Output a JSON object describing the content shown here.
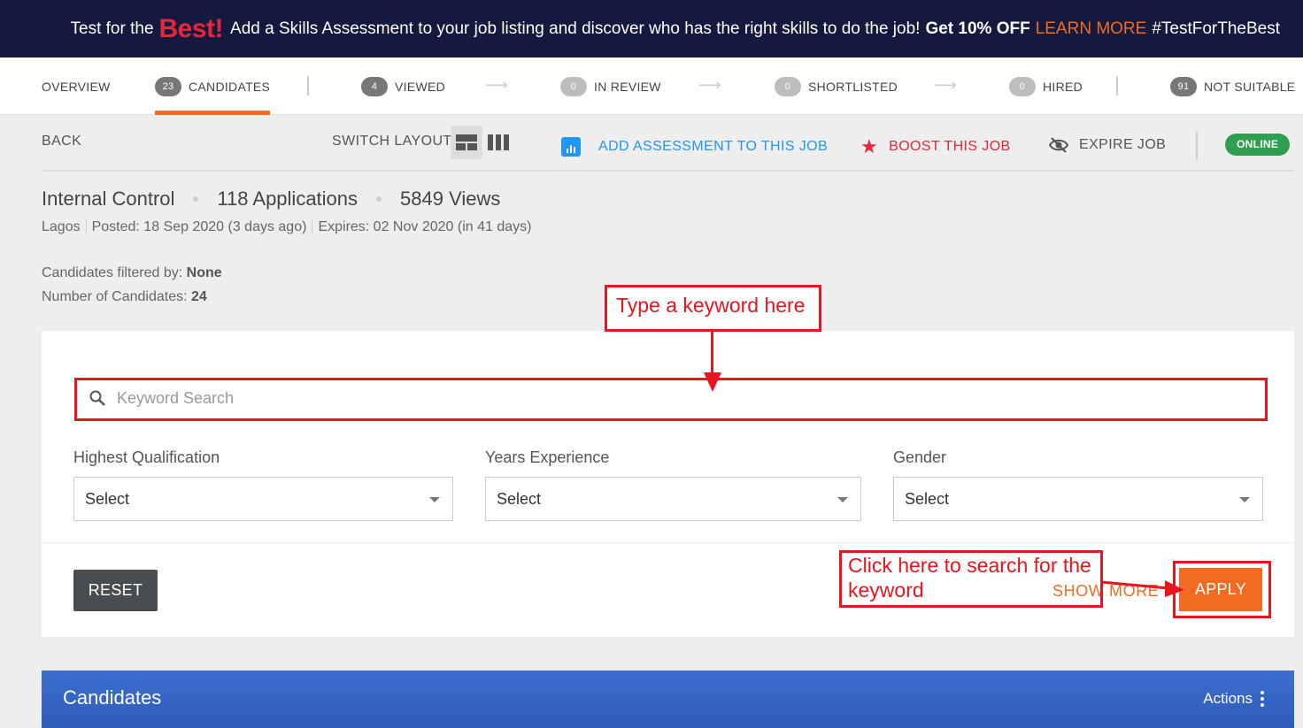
{
  "promo": {
    "lead": "Test for the",
    "best": "Best!",
    "text": "Add a Skills Assessment to your job listing and discover who has the right skills to do the job!",
    "discount": "Get 10% OFF",
    "learn_more": "LEARN MORE",
    "hashtag": "#TestForTheBest"
  },
  "steps": {
    "overview": "OVERVIEW",
    "candidates": {
      "count": "23",
      "label": "CANDIDATES"
    },
    "viewed": {
      "count": "4",
      "label": "VIEWED"
    },
    "in_review": {
      "count": "0",
      "label": "IN REVIEW"
    },
    "shortlisted": {
      "count": "0",
      "label": "SHORTLISTED"
    },
    "hired": {
      "count": "0",
      "label": "HIRED"
    },
    "not_suitable": {
      "count": "91",
      "label": "NOT SUITABLE"
    }
  },
  "toolbar": {
    "back": "BACK",
    "switch_layout": "SWITCH LAYOUT",
    "add_assessment": "ADD ASSESSMENT TO THIS JOB",
    "boost": "BOOST THIS JOB",
    "expire": "EXPIRE JOB",
    "status": "ONLINE"
  },
  "job": {
    "title": "Internal Control",
    "applications": "118 Applications",
    "views": "5849 Views",
    "location": "Lagos",
    "posted": "Posted: 18 Sep 2020 (3 days ago)",
    "expires": "Expires: 02 Nov 2020 (in 41 days)"
  },
  "filters": {
    "filtered_by_label": "Candidates filtered by:",
    "filtered_by_value": "None",
    "count_label": "Number of Candidates:",
    "count_value": "24",
    "keyword_placeholder": "Keyword Search",
    "qualification": {
      "label": "Highest Qualification",
      "value": "Select"
    },
    "experience": {
      "label": "Years Experience",
      "value": "Select"
    },
    "gender": {
      "label": "Gender",
      "value": "Select"
    },
    "reset": "RESET",
    "show_more": "SHOW MORE",
    "apply": "APPLY"
  },
  "candidates_panel": {
    "title": "Candidates",
    "actions": "Actions"
  },
  "annotations": {
    "keyword_hint": "Type a keyword here",
    "apply_hint_line1": "Click here to search for the",
    "apply_hint_line2": "keyword"
  },
  "colors": {
    "accent": "#f26b22",
    "banner": "#14193d",
    "link_blue": "#2196f3",
    "boost_red": "#e2283a",
    "online_green": "#2e9e50",
    "annotation_red": "#e8141e"
  }
}
